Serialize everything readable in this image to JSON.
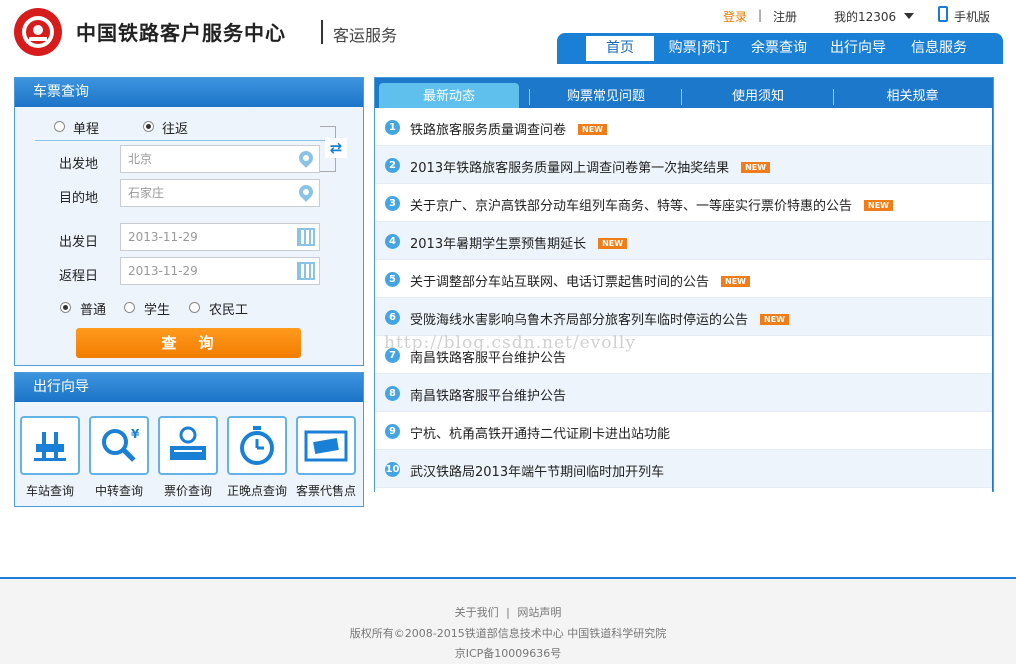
{
  "header": {
    "title": "中国铁路客户服务中心",
    "subtitle": "客运服务",
    "login": "登录",
    "separator": "|",
    "register": "注册",
    "my12306": "我的12306",
    "mobile": "手机版"
  },
  "nav": [
    "首页",
    "购票|预订",
    "余票查询",
    "出行向导",
    "信息服务"
  ],
  "ticket_query": {
    "title": "车票查询",
    "trip_types": [
      "单程",
      "往返"
    ],
    "selected_trip": "往返",
    "from_label": "出发地",
    "from_value": "北京",
    "to_label": "目的地",
    "to_value": "石家庄",
    "depart_label": "出发日",
    "depart_value": "2013-11-29",
    "return_label": "返程日",
    "return_value": "2013-11-29",
    "passenger_types": [
      "普通",
      "学生",
      "农民工"
    ],
    "selected_passenger": "普通",
    "search_button": "查询"
  },
  "travel_guide": {
    "title": "出行向导",
    "items": [
      "车站查询",
      "中转查询",
      "票价查询",
      "正晚点查询",
      "客票代售点"
    ]
  },
  "news": {
    "tabs": [
      "最新动态",
      "购票常见问题",
      "使用须知",
      "相关规章"
    ],
    "new_label": "NEW",
    "items": [
      {
        "num": "1",
        "text": "铁路旅客服务质量调查问卷",
        "new": true
      },
      {
        "num": "2",
        "text": "2013年铁路旅客服务质量网上调查问卷第一次抽奖结果",
        "new": true
      },
      {
        "num": "3",
        "text": "关于京广、京沪高铁部分动车组列车商务、特等、一等座实行票价特惠的公告",
        "new": true
      },
      {
        "num": "4",
        "text": "2013年暑期学生票预售期延长",
        "new": true
      },
      {
        "num": "5",
        "text": "关于调整部分车站互联网、电话订票起售时间的公告",
        "new": true
      },
      {
        "num": "6",
        "text": "受陇海线水害影响乌鲁木齐局部分旅客列车临时停运的公告",
        "new": true
      },
      {
        "num": "7",
        "text": "南昌铁路客服平台维护公告",
        "new": false
      },
      {
        "num": "8",
        "text": "南昌铁路客服平台维护公告",
        "new": false
      },
      {
        "num": "9",
        "text": "宁杭、杭甬高铁开通持二代证刷卡进出站功能",
        "new": false
      },
      {
        "num": "10",
        "text": "武汉铁路局2013年端午节期间临时加开列车",
        "new": false
      }
    ]
  },
  "watermark": "http://blog.csdn.net/evolly",
  "footer": {
    "about": "关于我们",
    "sep": "|",
    "statement": "网站声明",
    "copyright": "版权所有©2008-2015铁道部信息技术中心   中国铁道科学研究院",
    "icp": "京ICP备10009636号"
  },
  "colors": {
    "primary_blue": "#1a80d6",
    "accent_orange": "#f27d00",
    "light_blue": "#5fc0ee"
  }
}
